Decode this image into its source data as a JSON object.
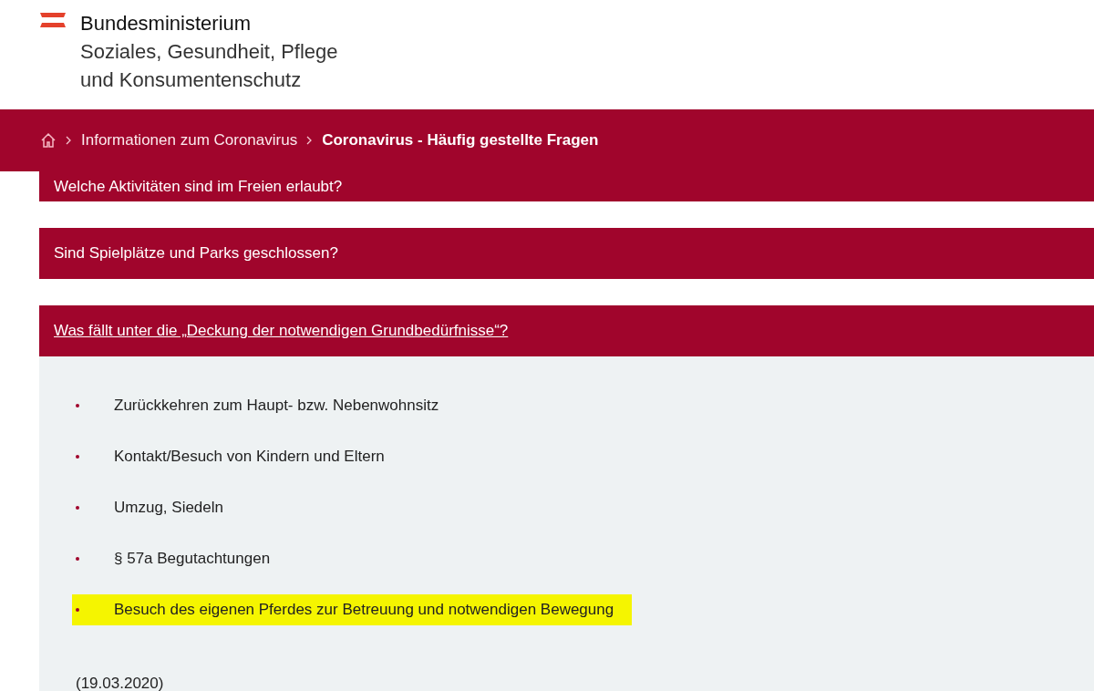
{
  "header": {
    "title": "Bundesministerium",
    "subtitle_lines": [
      "Soziales, Gesundheit, Pflege",
      "und Konsumentenschutz"
    ]
  },
  "breadcrumb": [
    {
      "label": "Informationen zum Coronavirus",
      "current": false
    },
    {
      "label": "Coronavirus - Häufig gestellte Fragen",
      "current": true
    }
  ],
  "faq": [
    {
      "question": "Welche Aktivitäten sind im Freien erlaubt?",
      "expanded": false
    },
    {
      "question": "Sind Spielplätze und Parks geschlossen?",
      "expanded": false
    },
    {
      "question": "Was fällt unter die „Deckung der notwendigen Grundbedürfnisse“?",
      "expanded": true,
      "items": [
        {
          "text": "Zurückkehren zum Haupt- bzw. Nebenwohnsitz",
          "highlighted": false
        },
        {
          "text": "Kontakt/Besuch von Kindern und Eltern",
          "highlighted": false
        },
        {
          "text": "Umzug, Siedeln",
          "highlighted": false
        },
        {
          "text": "§ 57a Begutachtungen",
          "highlighted": false
        },
        {
          "text": "Besuch des eigenen Pferdes zur Betreuung und notwendigen Bewegung",
          "highlighted": true
        }
      ],
      "date": "(19.03.2020)"
    }
  ]
}
